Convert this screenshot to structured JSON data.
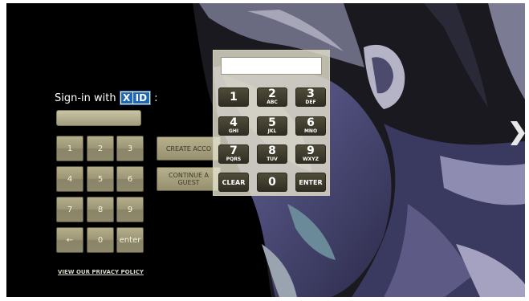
{
  "signin": {
    "label_prefix": "Sign-in with",
    "logo_x": "X",
    "logo_id": "ID",
    "label_suffix": ":"
  },
  "pinpad": {
    "keys": [
      "1",
      "2",
      "3",
      "4",
      "5",
      "6",
      "7",
      "8",
      "9",
      "←",
      "0",
      "enter"
    ]
  },
  "actions": {
    "create_account": "CREATE ACCO",
    "continue_line1": "CONTINUE A",
    "continue_line2": "GUEST"
  },
  "footer": {
    "privacy_link": "VIEW OUR PRIVACY POLICY"
  },
  "keypad": {
    "display_value": "",
    "keys": [
      {
        "digit": "1",
        "letters": ""
      },
      {
        "digit": "2",
        "letters": "ABC"
      },
      {
        "digit": "3",
        "letters": "DEF"
      },
      {
        "digit": "4",
        "letters": "GHI"
      },
      {
        "digit": "5",
        "letters": "JKL"
      },
      {
        "digit": "6",
        "letters": "MNO"
      },
      {
        "digit": "7",
        "letters": "PQRS"
      },
      {
        "digit": "8",
        "letters": "TUV"
      },
      {
        "digit": "9",
        "letters": "WXYZ"
      }
    ],
    "clear_label": "CLEAR",
    "zero_label": "0",
    "enter_label": "ENTER"
  },
  "colors": {
    "background": "#000000",
    "logo_blue": "#1f66b5",
    "key_dark": "#3f3b2d",
    "key_light": "#9c9676",
    "overlay": "#e2dfcc"
  },
  "icons": {
    "next": "chevron-right-icon"
  }
}
